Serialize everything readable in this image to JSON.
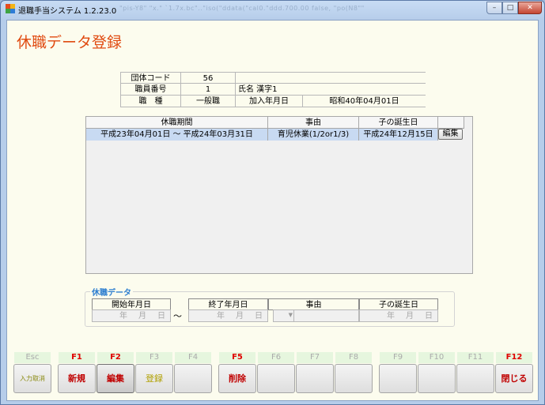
{
  "window": {
    "title": "退職手当システム 1.2.23.0",
    "ghost_text": "\"pis-Y8\" \"x.\" `1.7x.bc\"..\"iso(\"ddata(\"cal0.\"ddd.700.00 false, \"po(N8\"\"",
    "btn_min": "–",
    "btn_max": "□",
    "btn_close": "✕"
  },
  "page_title": "休職データ登録",
  "info": {
    "org_code_label": "団体コード",
    "org_code_value": "56",
    "emp_no_label": "職員番号",
    "emp_no_value": "1",
    "name_text": "氏名 漢字1",
    "job_label": "職　種",
    "job_value": "一般職",
    "join_label": "加入年月日",
    "join_value": "昭和40年04月01日"
  },
  "grid": {
    "headers": [
      "休職期間",
      "事由",
      "子の誕生日",
      ""
    ],
    "rows": [
      {
        "period": "平成23年04月01日 ～ 平成24年03月31日",
        "reason": "育児休業(1/2or1/3)",
        "birth": "平成24年12月15日",
        "action": "編集"
      }
    ]
  },
  "form": {
    "group_title": "休職データ",
    "start_label": "開始年月日",
    "end_label": "終了年月日",
    "reason_label": "事由",
    "birth_label": "子の誕生日",
    "date_placeholder": "年　月　日",
    "tilde": "～"
  },
  "fkeys": [
    {
      "key": "Esc",
      "label": "入力取消"
    },
    {
      "key": "F1",
      "label": "新規"
    },
    {
      "key": "F2",
      "label": "編集"
    },
    {
      "key": "F3",
      "label": "登録"
    },
    {
      "key": "F4",
      "label": ""
    },
    {
      "key": "F5",
      "label": "削除"
    },
    {
      "key": "F6",
      "label": ""
    },
    {
      "key": "F7",
      "label": ""
    },
    {
      "key": "F8",
      "label": ""
    },
    {
      "key": "F9",
      "label": ""
    },
    {
      "key": "F10",
      "label": ""
    },
    {
      "key": "F11",
      "label": ""
    },
    {
      "key": "F12",
      "label": "閉じる"
    }
  ],
  "colors": {
    "title_accent": "#e04a10",
    "selection": "#c8daf2",
    "fkey_active": "#c00000",
    "group_title": "#2f7fd0"
  }
}
